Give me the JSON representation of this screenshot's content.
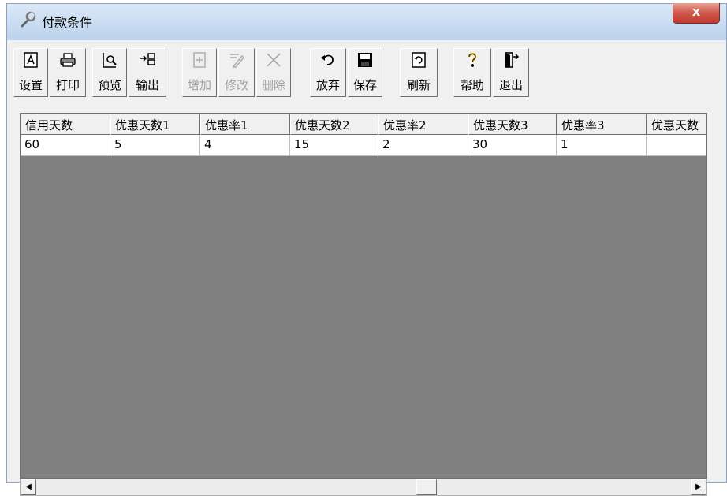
{
  "window": {
    "title": "付款条件",
    "close_label": "x"
  },
  "toolbar": {
    "buttons": [
      {
        "label": "设置",
        "icon": "settings-icon",
        "enabled": true
      },
      {
        "label": "打印",
        "icon": "printer-icon",
        "enabled": true
      },
      {
        "label": "预览",
        "icon": "preview-icon",
        "enabled": true
      },
      {
        "label": "输出",
        "icon": "export-icon",
        "enabled": true
      },
      {
        "label": "增加",
        "icon": "add-icon",
        "enabled": false
      },
      {
        "label": "修改",
        "icon": "edit-icon",
        "enabled": false
      },
      {
        "label": "删除",
        "icon": "delete-icon",
        "enabled": false
      },
      {
        "label": "放弃",
        "icon": "undo-icon",
        "enabled": true
      },
      {
        "label": "保存",
        "icon": "save-icon",
        "enabled": true
      },
      {
        "label": "刷新",
        "icon": "refresh-icon",
        "enabled": true
      },
      {
        "label": "帮助",
        "icon": "help-icon",
        "enabled": true
      },
      {
        "label": "退出",
        "icon": "exit-icon",
        "enabled": true
      }
    ]
  },
  "grid": {
    "columns": [
      "信用天数",
      "优惠天数1",
      "优惠率1",
      "优惠天数2",
      "优惠率2",
      "优惠天数3",
      "优惠率3",
      "优惠天数"
    ],
    "rows": [
      [
        "60",
        "5",
        "4",
        "15",
        "2",
        "30",
        "1",
        ""
      ]
    ]
  },
  "scrollbar": {
    "left_arrow": "◀",
    "right_arrow": "▶"
  },
  "colors": {
    "grid_background": "#808080",
    "window_background": "#f0f0f0",
    "close_button": "#c13b2d"
  }
}
